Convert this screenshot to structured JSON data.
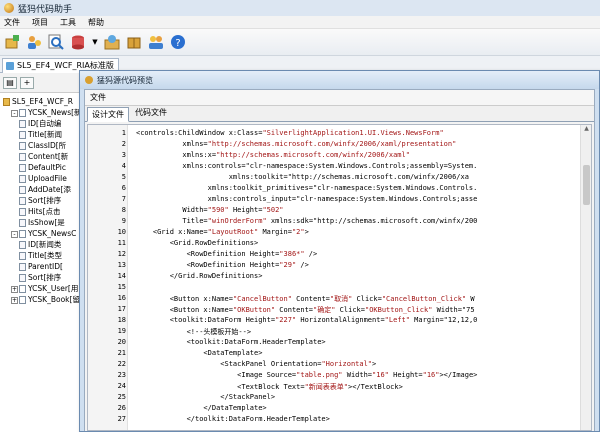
{
  "app": {
    "title": "猛犸代码助手",
    "icon": "app-logo-icon"
  },
  "menu": [
    "文件",
    "项目",
    "工具",
    "帮助"
  ],
  "toolbar": {
    "icons": [
      "new-project-icon",
      "users-icon",
      "search-icon",
      "database-icon",
      "settings-icon",
      "package-icon",
      "people-icon",
      "help-icon"
    ]
  },
  "doc_tab": {
    "label": "SL5_EF4_WCF_RIA标准版"
  },
  "left_panel": {
    "buttons": [
      "▤",
      "+"
    ],
    "tree": [
      {
        "label": "SL5_EF4_WCF_R",
        "kind": "db",
        "depth": 0
      },
      {
        "label": "YCSK_News[新",
        "kind": "table",
        "depth": 1,
        "expander": "-"
      },
      {
        "label": "ID[自动编",
        "kind": "field",
        "depth": 2
      },
      {
        "label": "Title[新闻",
        "kind": "field",
        "depth": 2
      },
      {
        "label": "ClassID[所",
        "kind": "field",
        "depth": 2
      },
      {
        "label": "Content[新",
        "kind": "field",
        "depth": 2
      },
      {
        "label": "DefaultPic",
        "kind": "field",
        "depth": 2
      },
      {
        "label": "UploadFile",
        "kind": "field",
        "depth": 2
      },
      {
        "label": "AddDate[添",
        "kind": "field",
        "depth": 2
      },
      {
        "label": "Sort[排序",
        "kind": "field",
        "depth": 2
      },
      {
        "label": "Hits[点击",
        "kind": "field",
        "depth": 2
      },
      {
        "label": "IsShow[是",
        "kind": "field",
        "depth": 2
      },
      {
        "label": "YCSK_NewsC",
        "kind": "table",
        "depth": 1,
        "expander": "-"
      },
      {
        "label": "ID[新闻类",
        "kind": "field",
        "depth": 2
      },
      {
        "label": "Title[类型",
        "kind": "field",
        "depth": 2
      },
      {
        "label": "ParentID[",
        "kind": "field",
        "depth": 2
      },
      {
        "label": "Sort[排序",
        "kind": "field",
        "depth": 2
      },
      {
        "label": "YCSK_User[用",
        "kind": "table",
        "depth": 1,
        "expander": "+"
      },
      {
        "label": "YCSK_Book[留",
        "kind": "table",
        "depth": 1,
        "expander": "+"
      }
    ]
  },
  "child_window": {
    "title": "猛犸源代码预览",
    "menu": "文件",
    "tabs": [
      "设计文件",
      "代码文件"
    ],
    "active_tab": 0
  },
  "code_lines": [
    {
      "n": "1",
      "text": "<controls:ChildWindow x:Class=\"SilverlightApplication1.UI.Views.NewsForm\""
    },
    {
      "n": "2",
      "text": "           xmlns=\"http://schemas.microsoft.com/winfx/2006/xaml/presentation\""
    },
    {
      "n": "3",
      "text": "           xmlns:x=\"http://schemas.microsoft.com/winfx/2006/xaml\""
    },
    {
      "n": "4",
      "text": "           xmlns:controls=\"clr-namespace:System.Windows.Controls;assembly=System."
    },
    {
      "n": "5",
      "text": "                      xmlns:toolkit=\"http://schemas.microsoft.com/winfx/2006/xa"
    },
    {
      "n": "6",
      "text": "                 xmlns:toolkit_primitives=\"clr-namespace:System.Windows.Controls."
    },
    {
      "n": "7",
      "text": "                 xmlns:controls_input=\"clr-namespace:System.Windows.Controls;asse"
    },
    {
      "n": "8",
      "text": "           Width=\"590\" Height=\"502\""
    },
    {
      "n": "9",
      "text": "           Title=\"winOrderForm\" xmlns:sdk=\"http://schemas.microsoft.com/winfx/200"
    },
    {
      "n": "10",
      "text": "    <Grid x:Name=\"LayoutRoot\" Margin=\"2\">"
    },
    {
      "n": "11",
      "text": "        <Grid.RowDefinitions>"
    },
    {
      "n": "12",
      "text": "            <RowDefinition Height=\"386*\" />"
    },
    {
      "n": "13",
      "text": "            <RowDefinition Height=\"29\" />"
    },
    {
      "n": "14",
      "text": "        </Grid.RowDefinitions>"
    },
    {
      "n": "15",
      "text": ""
    },
    {
      "n": "16",
      "text": "        <Button x:Name=\"CancelButton\" Content=\"取消\" Click=\"CancelButton_Click\" W"
    },
    {
      "n": "17",
      "text": "        <Button x:Name=\"OKButton\" Content=\"确定\" Click=\"OKButton_Click\" Width=\"75"
    },
    {
      "n": "18",
      "text": "        <toolkit:DataForm Height=\"227\" HorizontalAlignment=\"Left\" Margin=\"12,12,0"
    },
    {
      "n": "19",
      "text": "            <!--头模板开始-->"
    },
    {
      "n": "20",
      "text": "            <toolkit:DataForm.HeaderTemplate>"
    },
    {
      "n": "21",
      "text": "                <DataTemplate>"
    },
    {
      "n": "22",
      "text": "                    <StackPanel Orientation=\"Horizontal\">"
    },
    {
      "n": "23",
      "text": "                        <Image Source=\"table.png\" Width=\"16\" Height=\"16\"></Image>"
    },
    {
      "n": "24",
      "text": "                        <TextBlock Text=\"新闻表表单\"></TextBlock>"
    },
    {
      "n": "25",
      "text": "                    </StackPanel>"
    },
    {
      "n": "26",
      "text": "                </DataTemplate>"
    },
    {
      "n": "27",
      "text": "            </toolkit:DataForm.HeaderTemplate>"
    }
  ]
}
